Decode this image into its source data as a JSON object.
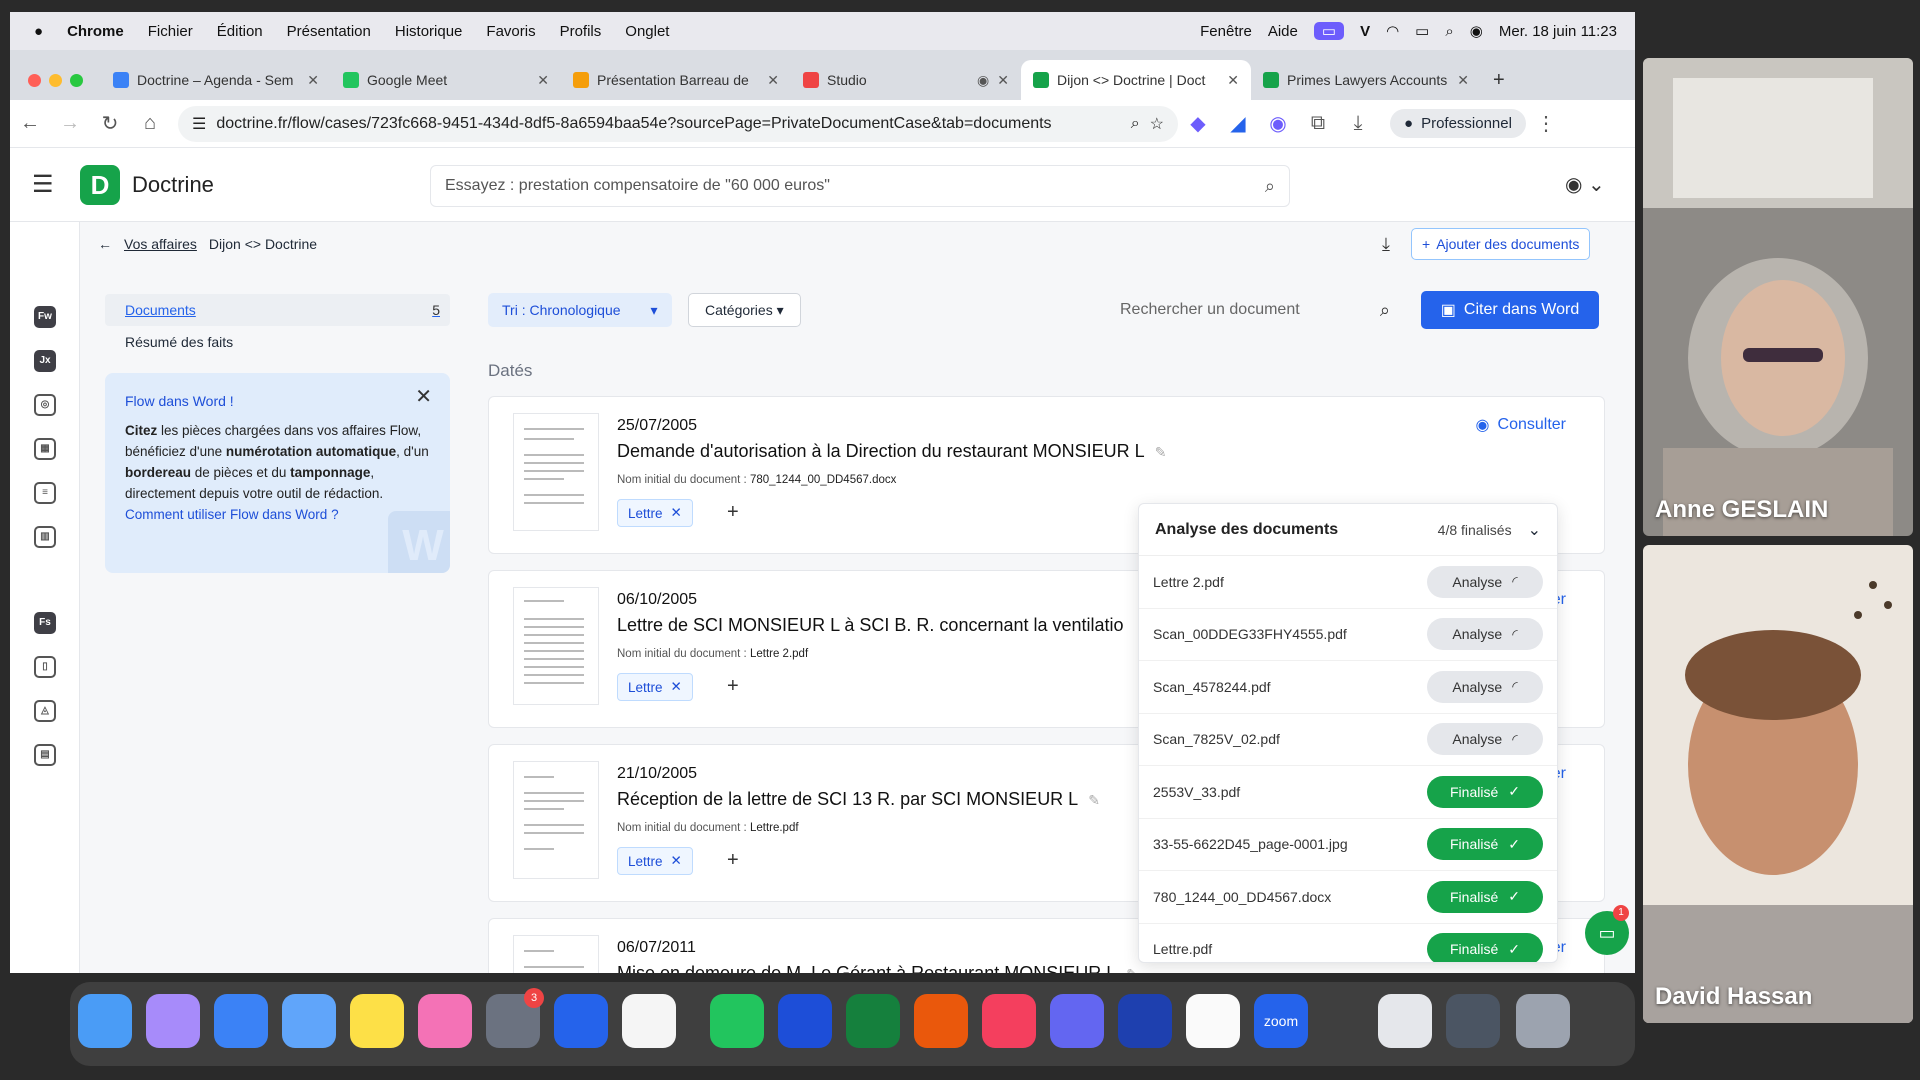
{
  "menubar": {
    "app": "Chrome",
    "items": [
      "Fichier",
      "Édition",
      "Présentation",
      "Historique",
      "Favoris",
      "Profils",
      "Onglet"
    ],
    "right_items": [
      "Fenêtre",
      "Aide"
    ],
    "clock": "Mer. 18 juin  11:23"
  },
  "tabs": [
    {
      "label": "Doctrine – Agenda - Sem",
      "color": "#3b82f6"
    },
    {
      "label": "Google Meet",
      "color": "#22c55e"
    },
    {
      "label": "Présentation Barreau de",
      "color": "#f59e0b"
    },
    {
      "label": "Studio",
      "color": "#ef4444"
    },
    {
      "label": "Dijon <> Doctrine | Doct",
      "color": "#16a34a"
    },
    {
      "label": "Primes Lawyers Accounts",
      "color": "#16a34a"
    }
  ],
  "address": {
    "url": "doctrine.fr/flow/cases/723fc668-9451-434d-8df5-8a6594baa54e?sourcePage=PrivateDocumentCase&tab=documents",
    "profile": "Professionnel"
  },
  "app": {
    "logo": "D",
    "brand": "Doctrine",
    "search_placeholder": "Essayez : prestation compensatoire de \"60 000 euros\"",
    "rail_items": [
      "Fw",
      "Jx",
      "Fs"
    ]
  },
  "breadcrumb": {
    "back": "Vos affaires",
    "current": "Dijon <> Doctrine"
  },
  "add_docs": "Ajouter des documents",
  "sidenav": [
    {
      "label": "Documents",
      "count": "5"
    },
    {
      "label": "Résumé des faits",
      "count": ""
    }
  ],
  "promo": {
    "title": "Flow dans Word !",
    "b1": "Citez",
    "t1": " les pièces chargées dans vos affaires Flow, bénéficiez d'une ",
    "b2": "numérotation automatique",
    "t2": ", d'un ",
    "b3": "bordereau",
    "t3": " de pièces et du ",
    "b4": "tamponnage",
    "t4": ", directement depuis votre outil de rédaction.",
    "link": "Comment utiliser Flow dans Word ?"
  },
  "toolbar": {
    "sort": "Tri : Chronologique",
    "categories": "Catégories",
    "doc_search_placeholder": "Rechercher un document",
    "cite": "Citer dans Word"
  },
  "section_title": "Datés",
  "meta_prefix": "Nom initial du document : ",
  "consult": "Consulter",
  "consult_fragment": "er",
  "documents": [
    {
      "date": "25/07/2005",
      "title": "Demande d'autorisation à la Direction du restaurant MONSIEUR L",
      "filename": "780_1244_00_DD4567.docx",
      "tag": "Lettre"
    },
    {
      "date": "06/10/2005",
      "title": "Lettre de SCI MONSIEUR L à SCI B. R. concernant la ventilatio",
      "filename": "Lettre 2.pdf",
      "tag": "Lettre"
    },
    {
      "date": "21/10/2005",
      "title": "Réception de la lettre de SCI 13 R. par SCI MONSIEUR L",
      "filename": "Lettre.pdf",
      "tag": "Lettre"
    },
    {
      "date": "06/07/2011",
      "title": "Mise en demeure de M. Le Gérant à Restaurant MONSIEUR L",
      "filename": "",
      "tag": ""
    }
  ],
  "analysis": {
    "title": "Analyse des documents",
    "status": "4/8 finalisés",
    "rows": [
      {
        "file": "Lettre 2.pdf",
        "state": "Analyse",
        "done": false
      },
      {
        "file": "Scan_00DDEG33FHY4555.pdf",
        "state": "Analyse",
        "done": false
      },
      {
        "file": "Scan_4578244.pdf",
        "state": "Analyse",
        "done": false
      },
      {
        "file": "Scan_7825V_02.pdf",
        "state": "Analyse",
        "done": false
      },
      {
        "file": "2553V_33.pdf",
        "state": "Finalisé",
        "done": true
      },
      {
        "file": "33-55-6622D45_page-0001.jpg",
        "state": "Finalisé",
        "done": true
      },
      {
        "file": "780_1244_00_DD4567.docx",
        "state": "Finalisé",
        "done": true
      },
      {
        "file": "Lettre.pdf",
        "state": "Finalisé",
        "done": true
      }
    ]
  },
  "chat_count": "1",
  "dock": {
    "settings_badge": "3",
    "zoom_label": "zoom"
  },
  "participants": [
    {
      "name": "Anne GESLAIN"
    },
    {
      "name": "David Hassan"
    }
  ]
}
